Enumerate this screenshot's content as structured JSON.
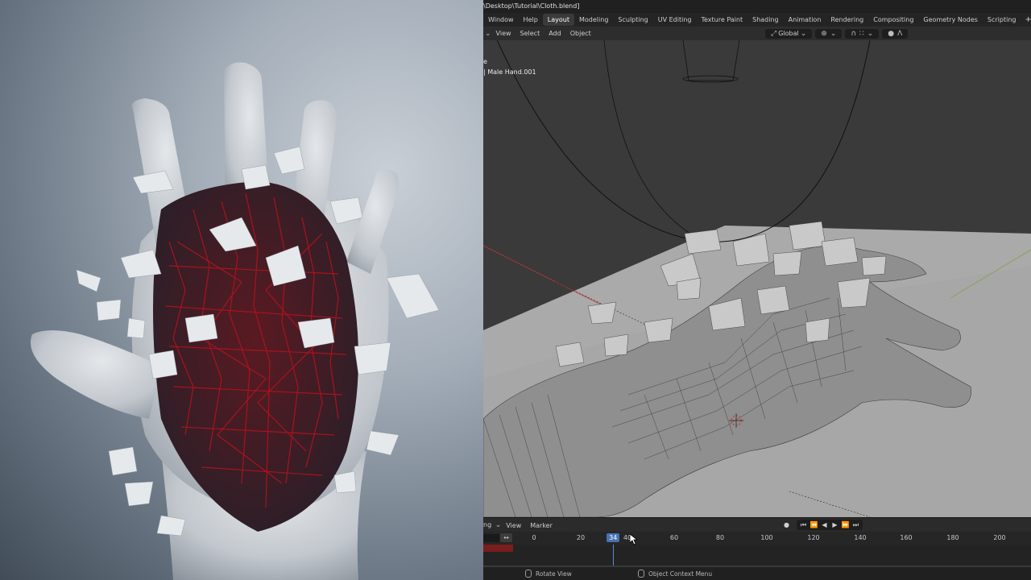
{
  "titlebar": {
    "path": "\\Desktop\\Tutorial\\Cloth.blend]"
  },
  "menu": {
    "items": [
      "Window",
      "Help"
    ]
  },
  "workspaces": {
    "tabs": [
      "Layout",
      "Modeling",
      "Sculpting",
      "UV Editing",
      "Texture Paint",
      "Shading",
      "Animation",
      "Rendering",
      "Compositing",
      "Geometry Nodes",
      "Scripting"
    ],
    "active": "Layout",
    "add_label": "+"
  },
  "viewport_header": {
    "menus": [
      "View",
      "Select",
      "Add",
      "Object"
    ],
    "orientation": "Global"
  },
  "viewport": {
    "overlay_line1": "e",
    "overlay_line2": "| Male Hand.001"
  },
  "timeline": {
    "mode_partial": "ng",
    "menus": [
      "View",
      "Marker"
    ],
    "ticks": [
      "0",
      "20",
      "40",
      "60",
      "80",
      "100",
      "120",
      "140",
      "160",
      "180",
      "200"
    ],
    "current_frame": "34",
    "current_frame_value": 34
  },
  "statusbar": {
    "item1": "Rotate View",
    "item2": "Object Context Menu"
  },
  "colors": {
    "accent": "#4772b3",
    "active_tab": "#3a3a3a",
    "wire_red": "#b3121e",
    "grid_red": "#c8353b",
    "grid_green": "#7ea13b"
  },
  "icons": {
    "playback": [
      "jump-start-icon",
      "prev-keyframe-icon",
      "play-reverse-icon",
      "play-icon",
      "next-keyframe-icon",
      "jump-end-icon"
    ]
  }
}
